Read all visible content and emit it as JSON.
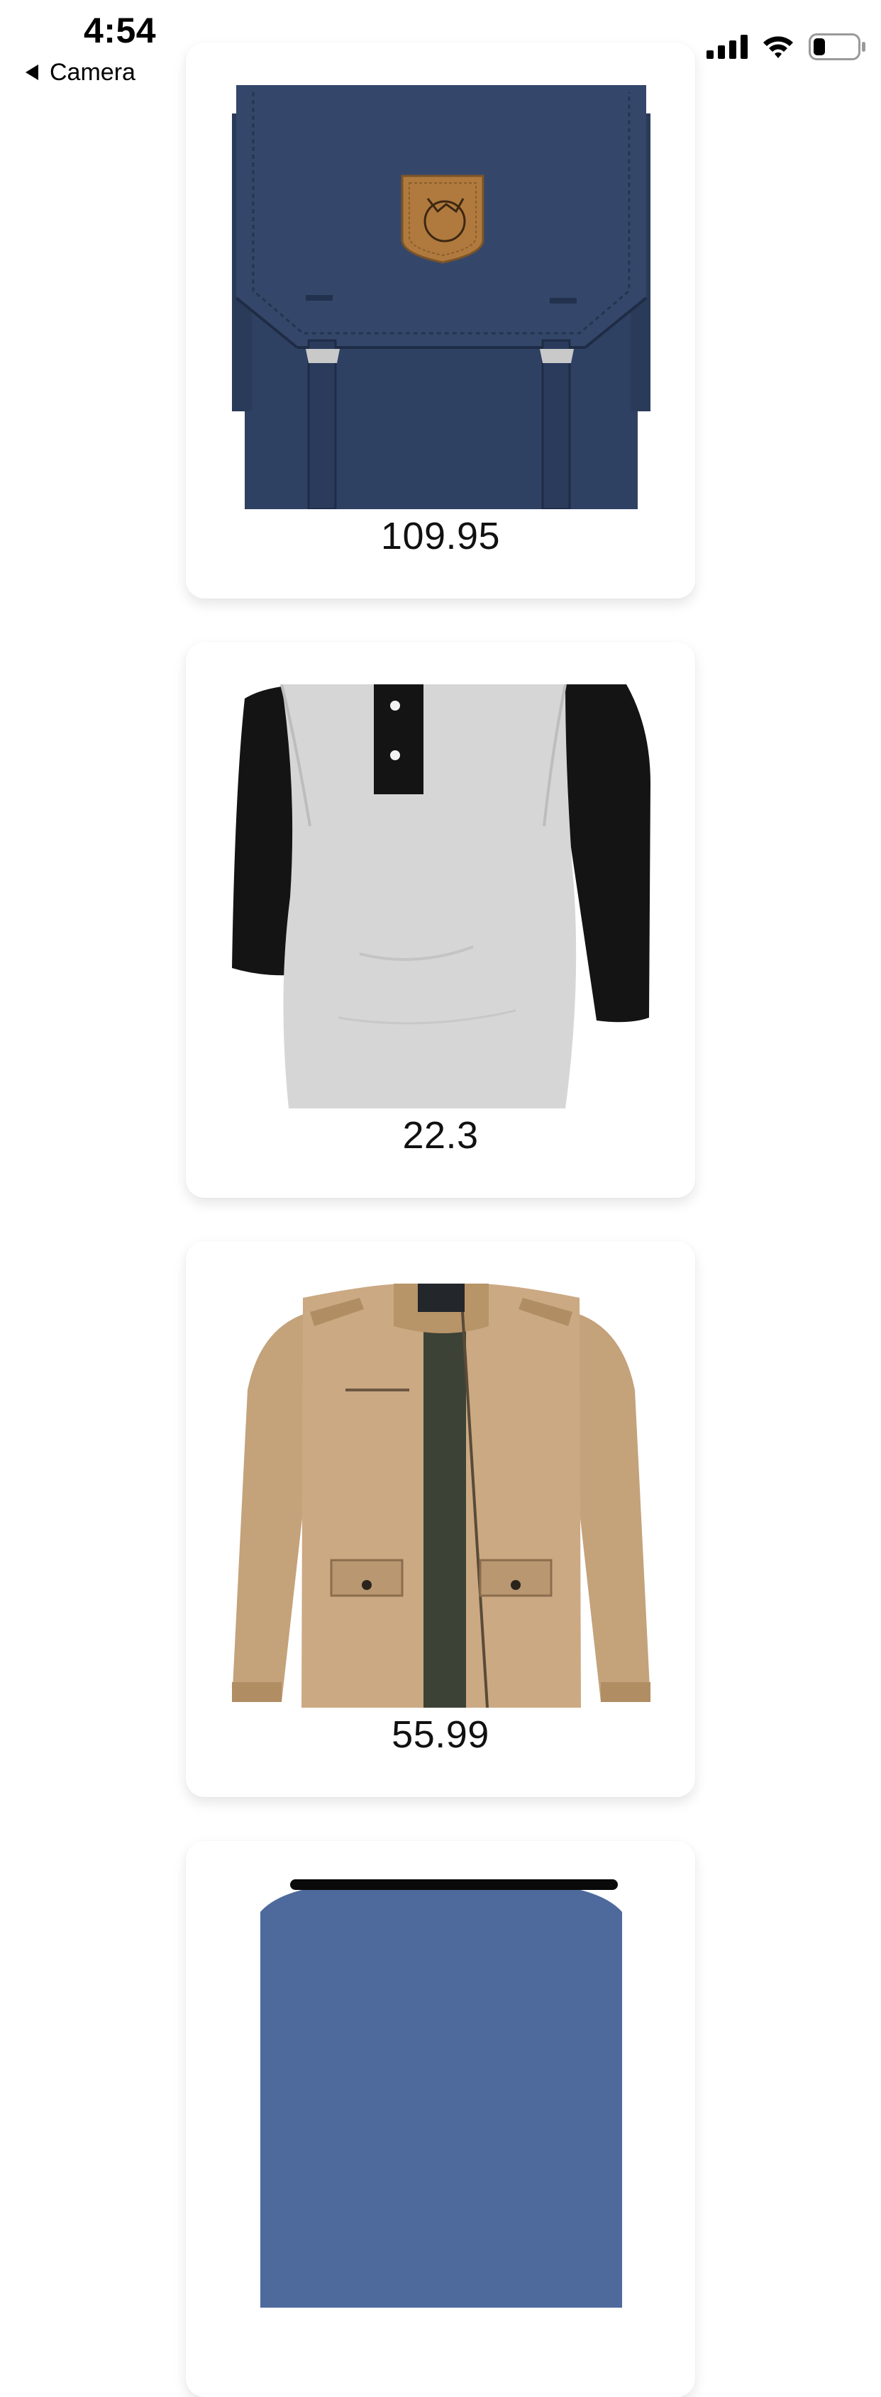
{
  "status_bar": {
    "time": "4:54",
    "back_label": "Camera",
    "icons": [
      "cellular-signal-icon",
      "wifi-icon",
      "battery-icon"
    ]
  },
  "products": [
    {
      "image": "navy-backpack-image",
      "price": "109.95"
    },
    {
      "image": "raglan-henley-shirt-image",
      "price": "22.3"
    },
    {
      "image": "khaki-jacket-image",
      "price": "55.99"
    },
    {
      "image": "blue-product-image",
      "price": ""
    }
  ],
  "colors": {
    "background": "#ffffff",
    "card": "#ffffff",
    "text": "#111111",
    "backpack": "#34476a",
    "shirt_body": "#d8d8d8",
    "shirt_sleeves": "#111111",
    "jacket": "#c9a983",
    "partial_item": "#4e6a9c"
  }
}
